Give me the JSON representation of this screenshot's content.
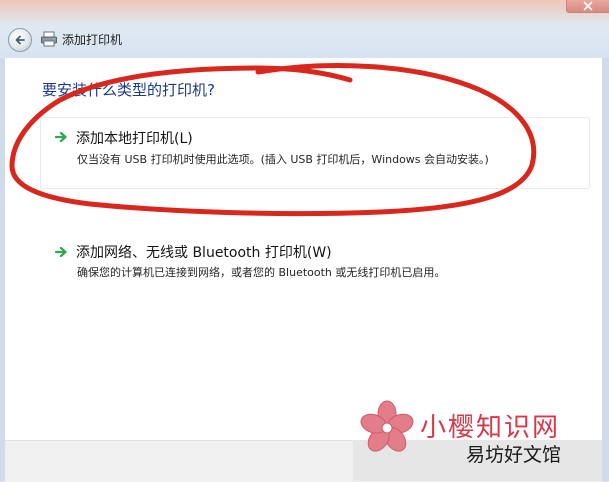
{
  "window": {
    "title": "添加打印机"
  },
  "main": {
    "heading": "要安装什么类型的打印机?",
    "options": [
      {
        "title": "添加本地打印机(L)",
        "description": "仅当没有 USB 打印机时使用此选项。(插入 USB 打印机后，Windows 会自动安装。)"
      },
      {
        "title": "添加网络、无线或 Bluetooth 打印机(W)",
        "description": "确保您的计算机已连接到网络，或者您的 Bluetooth 或无线打印机已启用。"
      }
    ]
  },
  "watermark": {
    "line1": "小樱知识网",
    "line2": "易坊好文馆"
  },
  "colors": {
    "heading": "#1a3a8a",
    "arrow": "#2fa84f",
    "annotation": "#d8271c",
    "watermark": "#d7394a"
  },
  "icons": {
    "back": "back-arrow-icon",
    "window": "printer-icon",
    "option": "green-arrow-icon",
    "close": "close-icon",
    "watermark": "sakura-flower-icon"
  }
}
